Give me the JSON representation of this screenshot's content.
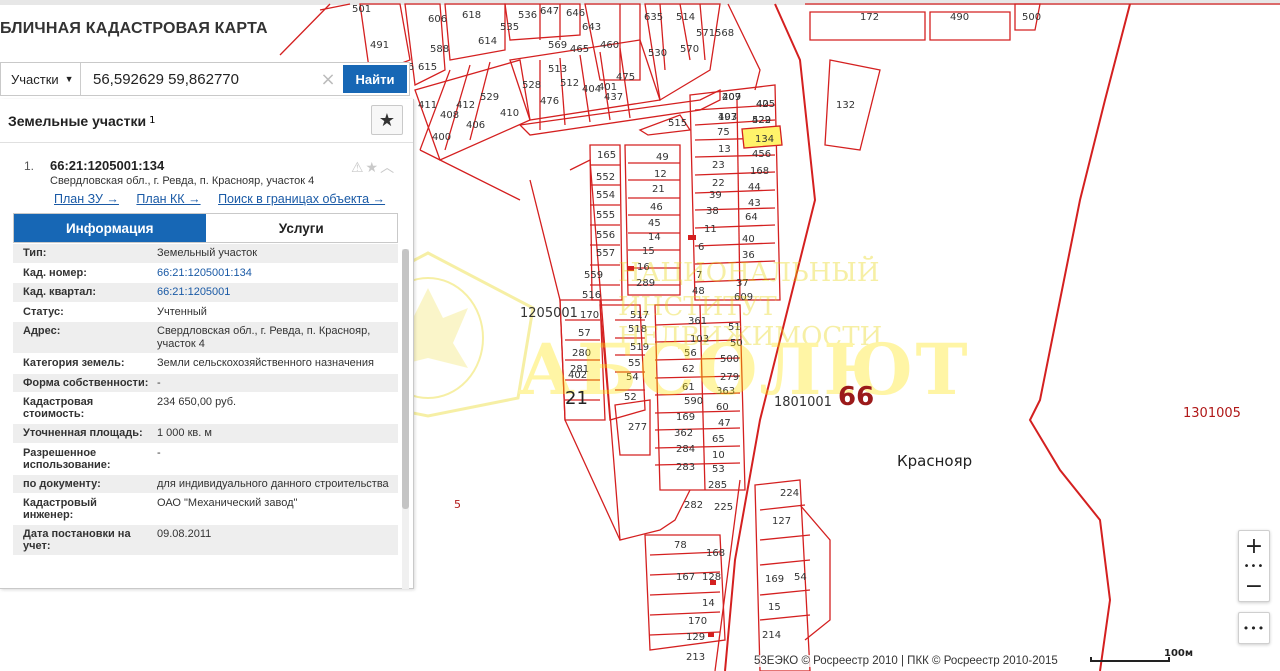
{
  "panel": {
    "title": "БЛИЧНАЯ КАДАСТРОВАЯ КАРТА",
    "search": {
      "type_label": "Участки",
      "value": "56,592629 59,862770",
      "button_label": "Найти"
    },
    "list_header": "Земельные участки",
    "list_count": "1",
    "result": {
      "number": "1.",
      "code": "66:21:1205001:134",
      "address": "Свердловская обл., г. Ревда, п. Краснояр, участок 4",
      "links": [
        "План ЗУ →",
        "План КК →",
        "Поиск в границах объекта →"
      ]
    },
    "tabs": [
      "Информация",
      "Услуги"
    ],
    "info": [
      {
        "key": "Тип:",
        "value": "Земельный участок"
      },
      {
        "key": "Кад. номер:",
        "value": "66:21:1205001:134",
        "link": true
      },
      {
        "key": "Кад. квартал:",
        "value": "66:21:1205001",
        "link": true
      },
      {
        "key": "Статус:",
        "value": "Учтенный"
      },
      {
        "key": "Адрес:",
        "value": "Свердловская обл., г. Ревда, п. Краснояр, участок 4"
      },
      {
        "key": "Категория земель:",
        "value": "Земли сельскохозяйственного назначения"
      },
      {
        "key": "Форма собственности:",
        "value": "-"
      },
      {
        "key": "Кадастровая стоимость:",
        "value": "234 650,00 руб."
      },
      {
        "key": "Уточненная площадь:",
        "value": "1 000 кв. м"
      },
      {
        "key": "Разрешенное использование:",
        "value": "-"
      },
      {
        "key": "по документу:",
        "value": "для индивидуального данного строительства"
      },
      {
        "key": "Кадастровый инженер:",
        "value": "ОАО \"Механический завод\""
      },
      {
        "key": "Дата постановки на учет:",
        "value": "09.08.2011"
      }
    ]
  },
  "map": {
    "labels": {
      "q1205001": "1205001",
      "q21": "21",
      "q1801001": "1801001",
      "region66": "66",
      "q1301005": "1301005",
      "settlement": "Краснояр",
      "p5": "5"
    },
    "parcel_numbers": [
      "207",
      "42",
      "193",
      "522",
      "75",
      "134",
      "13",
      "456",
      "23",
      "168",
      "22",
      "44",
      "39",
      "43",
      "38",
      "64",
      "11",
      "40",
      "6",
      "36",
      "7",
      "37",
      "48",
      "609",
      "49",
      "12",
      "21",
      "46",
      "45",
      "14",
      "15",
      "16",
      "289",
      "165",
      "552",
      "554",
      "555",
      "556",
      "557",
      "559",
      "516",
      "515",
      "170",
      "517",
      "361",
      "51",
      "57",
      "518",
      "103",
      "50",
      "280",
      "519",
      "56",
      "500",
      "281",
      "55",
      "62",
      "279",
      "402",
      "54",
      "61",
      "363",
      "52",
      "590",
      "60",
      "277",
      "169",
      "47",
      "362",
      "65",
      "284",
      "10",
      "283",
      "53",
      "285",
      "282",
      "225",
      "224",
      "127",
      "78",
      "168",
      "167",
      "128",
      "169",
      "54",
      "14",
      "15",
      "170",
      "129",
      "214",
      "213",
      "132",
      "172",
      "490",
      "500",
      "501",
      "491",
      "596",
      "606",
      "588",
      "615",
      "618",
      "614",
      "535",
      "536",
      "647",
      "646",
      "643",
      "635",
      "530",
      "514",
      "570",
      "571",
      "568",
      "569",
      "465",
      "460",
      "401",
      "475",
      "513",
      "512",
      "404",
      "437",
      "528",
      "476",
      "412",
      "529",
      "411",
      "408",
      "406",
      "410",
      "400",
      "409",
      "405",
      "407",
      "429"
    ],
    "watermark": {
      "line1": "НАЦИОНАЛЬНЫЙ",
      "line2": "ИНСТИТУТ НЕДВИЖИМОСТИ",
      "big": "АБСОЛЮТ"
    },
    "attribution": "ЕЭКО © Росреестр 2010 | ПКК © Росреестр 2010-2015",
    "attribution_prefix": "53",
    "scale_label": "100м",
    "colors": {
      "parcel_line": "#d42020",
      "highlight": "#ffee55",
      "accent": "#1767b5"
    }
  },
  "controls": {
    "zoom_in": "+",
    "zoom_dots": "•••",
    "zoom_out": "−",
    "more": "•••",
    "favorite_icon": "★"
  }
}
